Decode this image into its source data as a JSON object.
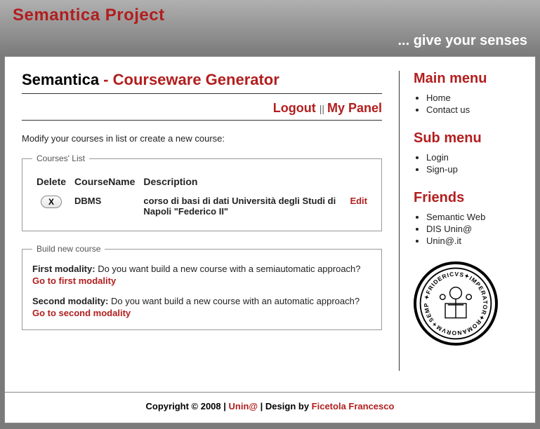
{
  "header": {
    "site_title": "Semantica Project",
    "tagline": "... give your senses"
  },
  "page": {
    "title_black": "Semantica",
    "title_red": " - Courseware Generator",
    "actions": {
      "logout": "Logout",
      "sep": " || ",
      "mypanel": "My Panel"
    },
    "instruction": "Modify your courses in list or create a new course:"
  },
  "courses_list": {
    "legend": "Courses' List",
    "cols": {
      "delete": "Delete",
      "name": "CourseName",
      "desc": "Description"
    },
    "rows": [
      {
        "delete_label": "X",
        "name": "DBMS",
        "desc": "corso di basi di dati Università degli Studi di Napoli \"Federico II\"",
        "edit": "Edit"
      }
    ]
  },
  "build": {
    "legend": "Build new course",
    "first": {
      "label": "First modality:",
      "text": " Do you want build a new course with a semiautomatic approach?",
      "link": "Go to first modality"
    },
    "second": {
      "label": "Second modality:",
      "text": " Do you want build a new course with an automatic approach?",
      "link": "Go to second modality"
    }
  },
  "sidebar": {
    "main": {
      "title": "Main menu",
      "items": [
        "Home",
        "Contact us"
      ]
    },
    "sub": {
      "title": "Sub menu",
      "items": [
        "Login",
        "Sign-up"
      ]
    },
    "friends": {
      "title": "Friends",
      "items": [
        "Semantic Web",
        "DIS Unin@",
        "Unin@.it"
      ]
    }
  },
  "footer": {
    "copyright": "Copyright © 2008 | ",
    "link1": "Unin@",
    "sep": " | Design by ",
    "link2": "Ficetola Francesco"
  }
}
